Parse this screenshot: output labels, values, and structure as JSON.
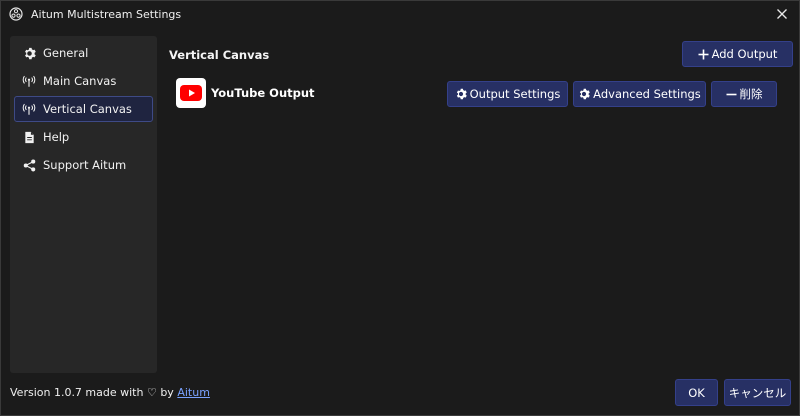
{
  "window": {
    "title": "Aitum Multistream Settings"
  },
  "sidebar": {
    "items": [
      {
        "label": "General",
        "icon": "gear-icon"
      },
      {
        "label": "Main Canvas",
        "icon": "antenna-icon"
      },
      {
        "label": "Vertical Canvas",
        "icon": "antenna-icon",
        "active": true
      },
      {
        "label": "Help",
        "icon": "document-icon"
      },
      {
        "label": "Support Aitum",
        "icon": "share-icon"
      }
    ]
  },
  "main": {
    "section_title": "Vertical Canvas",
    "add_output_label": "Add Output",
    "outputs": [
      {
        "name": "YouTube Output",
        "icon": "youtube-icon",
        "output_settings_label": "Output Settings",
        "advanced_settings_label": "Advanced Settings",
        "delete_label": "削除"
      }
    ]
  },
  "footer": {
    "version_text": "Version 1.0.7 made with ♡ by ",
    "link_text": "Aitum",
    "ok_label": "OK",
    "cancel_label": "キャンセル"
  },
  "colors": {
    "window_bg": "#1b1b1b",
    "sidebar_bg": "#272727",
    "button_bg": "#273064",
    "link": "#7aa2ff",
    "youtube_red": "#ff0000"
  }
}
